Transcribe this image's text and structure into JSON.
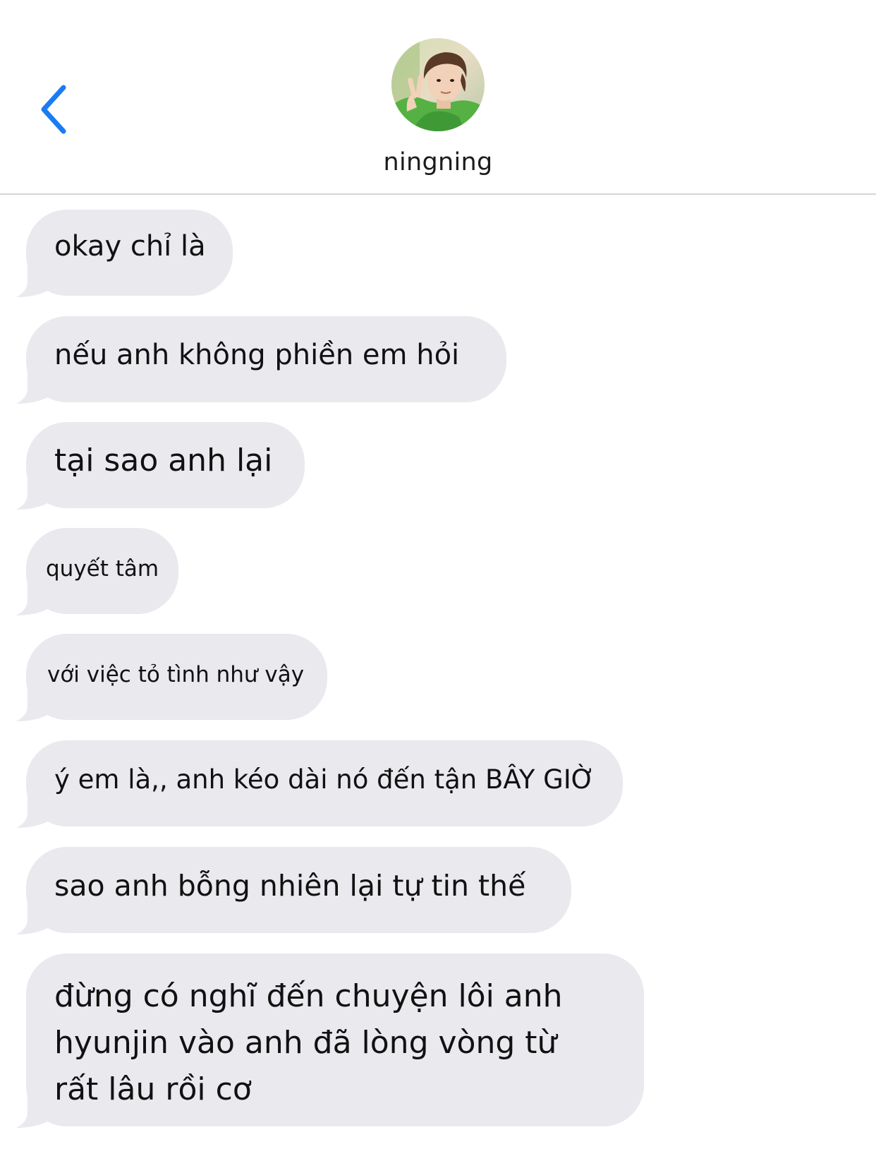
{
  "header": {
    "back_label": "back",
    "contact_name": "ningning"
  },
  "colors": {
    "accent": "#1a7cf3",
    "bubble_incoming": "#e9e9ee",
    "divider": "#d6d6d8",
    "text": "#111111"
  },
  "messages": [
    {
      "text": "okay chỉ là"
    },
    {
      "text": "nếu anh không phiền em hỏi"
    },
    {
      "text": "tại sao anh lại"
    },
    {
      "text": "quyết tâm"
    },
    {
      "text": "với việc tỏ tình như vậy"
    },
    {
      "text": "ý em là,, anh kéo dài nó đến tận BÂY GIỜ"
    },
    {
      "text": "sao anh bỗng nhiên lại tự tin thế"
    },
    {
      "lines": [
        "đừng có nghĩ đến chuyện lôi anh",
        "hyunjin vào anh đã lòng vòng từ",
        "rất lâu rồi cơ"
      ]
    }
  ]
}
